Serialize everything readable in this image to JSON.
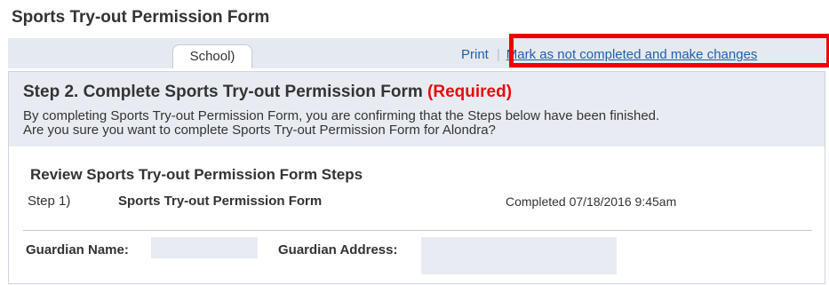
{
  "page": {
    "title": "Sports Try-out Permission Form"
  },
  "tabs": [
    {
      "label": "School)"
    }
  ],
  "actions": {
    "print_label": "Print",
    "separator": "|",
    "mark_incomplete_label": "Mark as not completed and make changes"
  },
  "highlight_color": "#ee0000",
  "step": {
    "title": "Step 2. Complete Sports Try-out Permission Form",
    "required_label": "(Required)",
    "desc_line1": "By completing Sports Try-out Permission Form, you are confirming that the Steps below have been finished.",
    "desc_line2": "Are you sure you want to complete Sports Try-out Permission Form for Alondra?"
  },
  "review": {
    "title": "Review Sports Try-out Permission Form Steps",
    "steps": [
      {
        "number": "Step 1)",
        "name": "Sports Try-out Permission Form",
        "status": "Completed 07/18/2016 9:45am"
      }
    ]
  },
  "guardian": {
    "name_label": "Guardian Name:",
    "name_value": "",
    "address_label": "Guardian Address:",
    "address_value": ""
  },
  "colors": {
    "link": "#1f5fae",
    "required": "#e01010",
    "header_bg": "#e8ecf2"
  }
}
